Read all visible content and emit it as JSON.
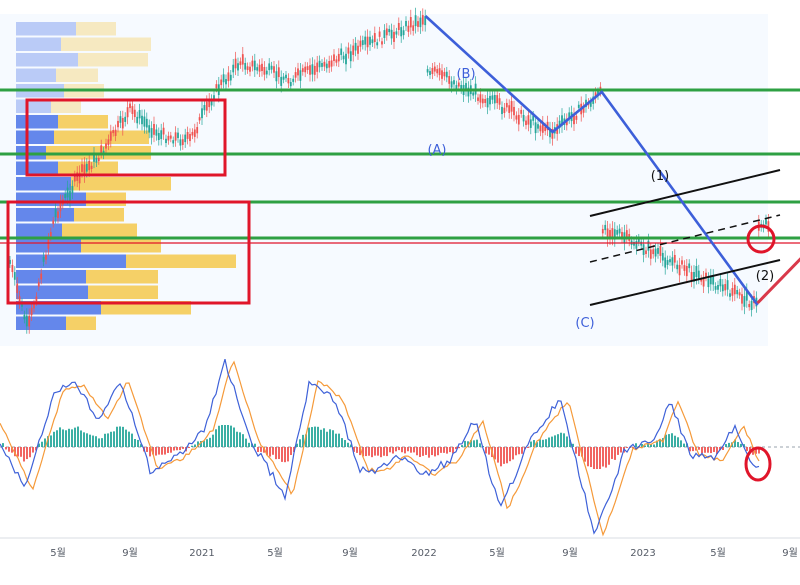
{
  "colors": {
    "blue_line": "#3d5fd9",
    "red_line": "#d9394a",
    "green_level": "#2ea043",
    "red_box": "#e0152a",
    "profile_blue": "#4a72e8",
    "profile_yellow": "#f5c84c",
    "candle_up": "#26a69a",
    "candle_down": "#ef5350",
    "macd_blue": "#3e61d8",
    "macd_orange": "#f59a3a",
    "hist_up": "#26a69a",
    "hist_down": "#ef5350",
    "channel": "#111111",
    "panel_bg": "#eef5ff"
  },
  "chart_data": [
    {
      "type": "line",
      "panel": "price",
      "elliott_labels": [
        "(A)",
        "(B)",
        "(C)",
        "(1)",
        "(2)"
      ],
      "wave_points": [
        {
          "label": "peak",
          "x": "2021-08-15"
        },
        {
          "label": "(A)",
          "x": "2022-01-20"
        },
        {
          "label": "(B)",
          "x": "2022-03-20"
        },
        {
          "label": "(C)",
          "x": "2022-09-30"
        },
        {
          "label": "(1)",
          "x": "2023-02-01"
        },
        {
          "label": "(2)",
          "x": "2023-06-20"
        }
      ],
      "horizontal_levels": 5,
      "red_zones": 2,
      "grid": true
    },
    {
      "type": "bar",
      "panel": "oscillator",
      "x_ticks": [
        "5월",
        "9월",
        "2021",
        "5월",
        "9월",
        "2022",
        "5월",
        "9월",
        "2023",
        "5월",
        "9월"
      ],
      "zero_line": true,
      "grid": false
    }
  ]
}
